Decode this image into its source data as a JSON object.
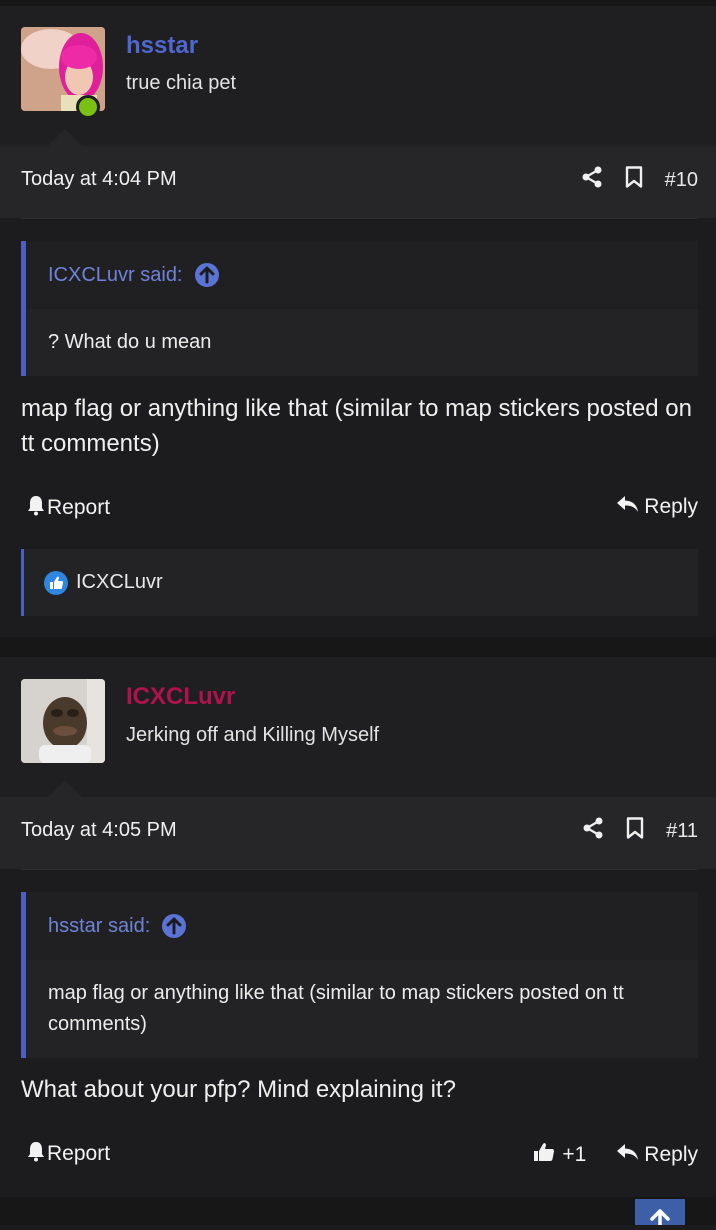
{
  "posts": [
    {
      "username": "hsstar",
      "username_color": "#4f67cf",
      "user_title": "true chia pet",
      "timestamp": "Today at 4:04 PM",
      "post_number": "#10",
      "quote_author": "ICXCLuvr said:",
      "quote_text": "? What do u mean",
      "body": "map flag or anything like that (similar to map stickers posted on tt comments)",
      "report_label": "Report",
      "reply_label": "Reply",
      "liked_by": "ICXCLuvr"
    },
    {
      "username": "ICXCLuvr",
      "username_color": "#b0124d",
      "user_title": "Jerking off and Killing Myself",
      "timestamp": "Today at 4:05 PM",
      "post_number": "#11",
      "quote_author": "hsstar said:",
      "quote_text": "map flag or anything like that (similar to map stickers posted on tt comments)",
      "body": "What about your pfp? Mind explaining it?",
      "report_label": "Report",
      "like_count": "+1",
      "reply_label": "Reply"
    }
  ],
  "icons": [
    "share-icon",
    "bookmark-icon",
    "bell-icon",
    "reply-icon",
    "thumbs-up-icon",
    "arrow-up-icon"
  ],
  "colors": {
    "accent": "#4b5fc4",
    "online": "#7bc114",
    "like": "#2f86e0"
  }
}
